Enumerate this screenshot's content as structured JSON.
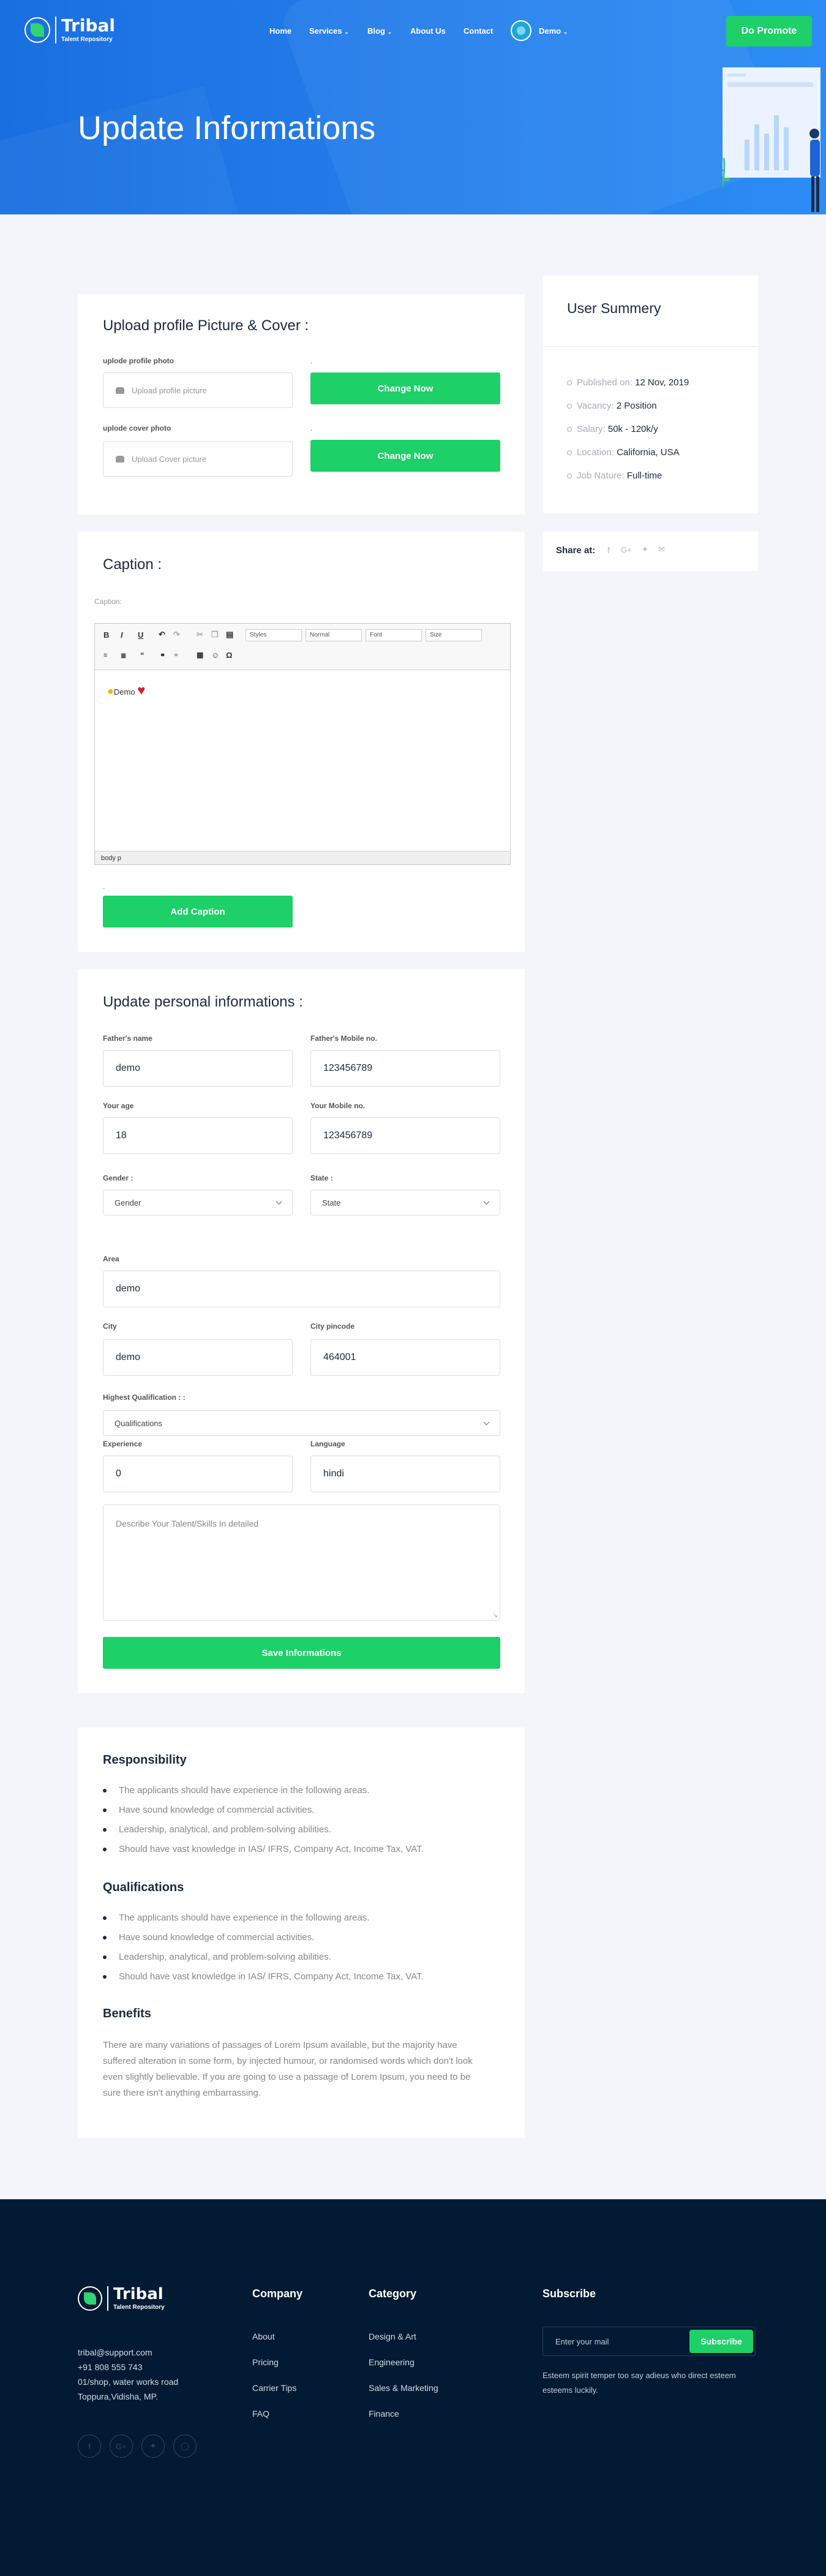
{
  "brand": {
    "name": "Tribal",
    "tagline": "Talent Repository"
  },
  "nav": {
    "items": [
      "Home",
      "Services",
      "Blog",
      "About Us",
      "Contact"
    ],
    "user": "Demo",
    "promote": "Do Promote"
  },
  "hero": {
    "title": "Update Informations"
  },
  "upload": {
    "title": "Upload profile Picture & Cover :",
    "profile_label": "uplode profile photo",
    "profile_placeholder": "Upload profile picture",
    "cover_label": "uplode cover photo",
    "cover_placeholder": "Upload Cover picture",
    "change_label": "Change Now",
    "dot": "."
  },
  "caption": {
    "title": "Caption :",
    "label": "Caption:",
    "toolbar": {
      "styles": "Styles",
      "normal": "Normal",
      "font": "Font",
      "size": "Size"
    },
    "content_text": "Demo",
    "status": "body  p",
    "dot": ".",
    "button": "Add Caption"
  },
  "personal": {
    "title": "Update personal informations :",
    "fathers_name_label": "Father's name",
    "fathers_name": "demo",
    "fathers_mobile_label": "Father's Mobile no.",
    "fathers_mobile": "123456789",
    "age_label": "Your age",
    "age": "18",
    "mobile_label": "Your Mobile no.",
    "mobile": "123456789",
    "gender_label": "Gender :",
    "gender": "Gender",
    "state_label": "State :",
    "state": "State",
    "area_label": "Area",
    "area": "demo",
    "city_label": "City",
    "city": "demo",
    "pincode_label": "City pincode",
    "pincode": "464001",
    "qualification_label": "Highest Qualification : :",
    "qualification": "Qualifications",
    "experience_label": "Experience",
    "experience": "0",
    "language_label": "Language",
    "language": "hindi",
    "describe_placeholder": "Describe Your Talent/Skills In detailed",
    "save": "Save Informations"
  },
  "summary": {
    "title": "User Summery",
    "items": [
      {
        "k": "Published on:",
        "v": "12 Nov, 2019"
      },
      {
        "k": "Vacancy:",
        "v": "2 Position"
      },
      {
        "k": "Salary:",
        "v": "50k - 120k/y"
      },
      {
        "k": "Location:",
        "v": "California, USA"
      },
      {
        "k": "Job Nature:",
        "v": "Full-time"
      }
    ],
    "share": "Share at:"
  },
  "details": {
    "responsibility_title": "Responsibility",
    "responsibility": [
      "The applicants should have experience in the following areas.",
      "Have sound knowledge of commercial activities.",
      "Leadership, analytical, and problem-solving abilities.",
      "Should have vast knowledge in IAS/ IFRS, Company Act, Income Tax, VAT."
    ],
    "qualifications_title": "Qualifications",
    "qualifications": [
      "The applicants should have experience in the following areas.",
      "Have sound knowledge of commercial activities.",
      "Leadership, analytical, and problem-solving abilities.",
      "Should have vast knowledge in IAS/ IFRS, Company Act, Income Tax, VAT."
    ],
    "benefits_title": "Benefits",
    "benefits_lines": [
      "There are many variations of passages of Lorem Ipsum available, but the majority have",
      "suffered alteration in some form, by injected humour, or randomised words which don't look",
      "even slightly believable. If you are going to use a passage of Lorem Ipsum, you need to be",
      "sure there isn't anything embarrassing."
    ]
  },
  "footer": {
    "email": "tribal@support.com",
    "phone": "+91 808 555 743",
    "addr1": "01/shop, water works road",
    "addr2": "Toppura,Vidisha, MP.",
    "company_title": "Company",
    "company": [
      "About",
      "Pricing",
      "Carrier Tips",
      "FAQ"
    ],
    "category_title": "Category",
    "category": [
      "Design & Art",
      "Engineering",
      "Sales & Marketing",
      "Finance"
    ],
    "subscribe_title": "Subscribe",
    "subscribe_placeholder": "Enter your mail",
    "subscribe_button": "Subscribe",
    "subscribe_text1": "Esteem spirit temper too say adieus who direct esteem",
    "subscribe_text2": "esteems luckily."
  },
  "colors": {
    "primary": "#1a6fe0",
    "accent": "#1dd068",
    "footer": "#021a33"
  }
}
